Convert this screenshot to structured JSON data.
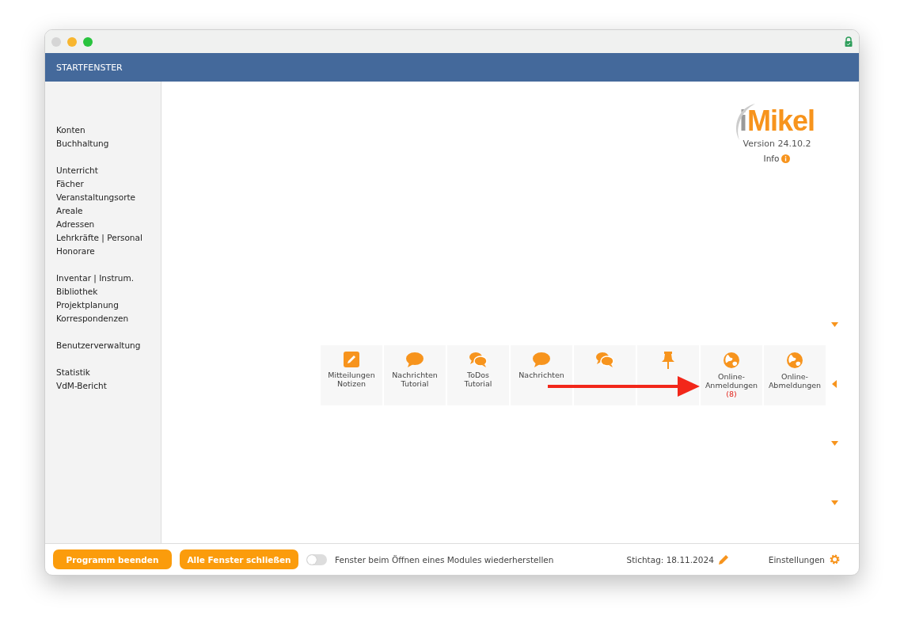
{
  "window": {
    "title": "STARTFENSTER"
  },
  "sidebar": {
    "groups": [
      {
        "items": [
          "Konten",
          "Buchhaltung"
        ]
      },
      {
        "items": [
          "Unterricht",
          "Fächer",
          "Veranstaltungsorte",
          "Areale",
          "Adressen",
          "Lehrkräfte | Personal",
          "Honorare"
        ]
      },
      {
        "items": [
          "Inventar | Instrum.",
          "Bibliothek",
          "Projektplanung",
          "Korrespondenzen"
        ]
      },
      {
        "items": [
          "Benutzerverwaltung"
        ]
      },
      {
        "items": [
          "Statistik",
          "VdM-Bericht"
        ]
      }
    ]
  },
  "logo": {
    "letter": "i",
    "name": "Mikel",
    "version": "Version 24.10.2",
    "info": "Info"
  },
  "tiles": [
    {
      "kind": "edit",
      "label": [
        "Mitteilungen",
        "Notizen"
      ]
    },
    {
      "kind": "bubble",
      "label": [
        "Nachrichten",
        "Tutorial"
      ]
    },
    {
      "kind": "bubbles",
      "label": [
        "ToDos",
        "Tutorial"
      ]
    },
    {
      "kind": "bubble",
      "label": [
        "Nachrichten"
      ]
    },
    {
      "kind": "bubbles"
    },
    {
      "kind": "pin"
    },
    {
      "kind": "globe",
      "label": [
        "Online-",
        "Anmeldungen"
      ],
      "count": "(8)"
    },
    {
      "kind": "globe",
      "label": [
        "Online-",
        "Abmeldungen"
      ]
    }
  ],
  "footer": {
    "buttons": [
      "Programm beenden",
      "Alle Fenster schließen"
    ],
    "toggle": {
      "label": "Fenster beim Öffnen eines Modules wiederherstellen",
      "on": false
    },
    "date": "Stichtag: 18.11.2024",
    "settings": "Einstellungen"
  }
}
